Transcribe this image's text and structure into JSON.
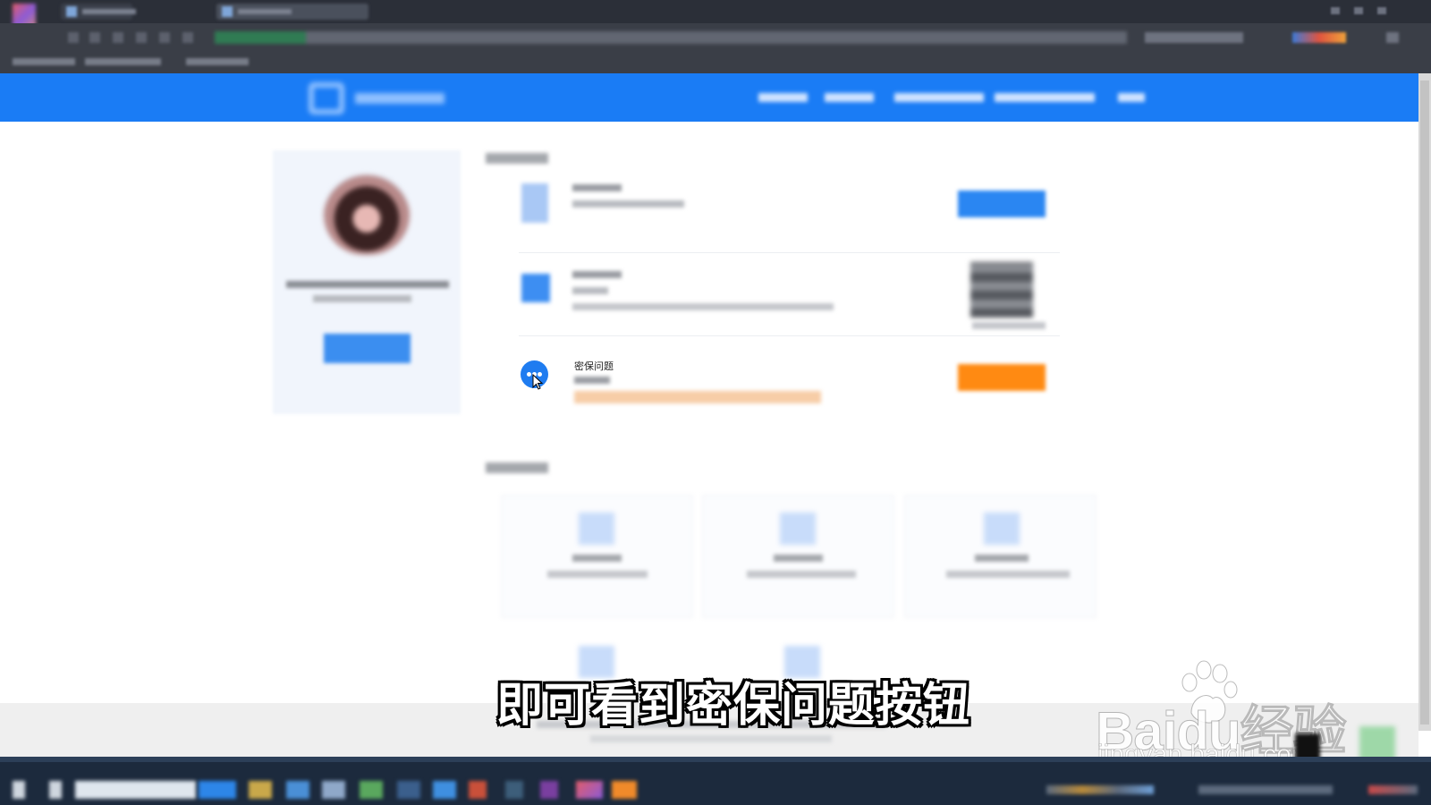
{
  "page": {
    "security_item": {
      "title": "密保问题",
      "icon": "chat-bubble-icon"
    },
    "caption": "即可看到密保问题按钮",
    "watermark": {
      "brand": "Baidu经验",
      "url": "jingyan.baidu.com"
    }
  },
  "colors": {
    "header_blue": "#1a7cf5",
    "action_blue": "#3b8ef0",
    "action_orange": "#ff8a12",
    "taskbar": "#1c2a3d"
  }
}
